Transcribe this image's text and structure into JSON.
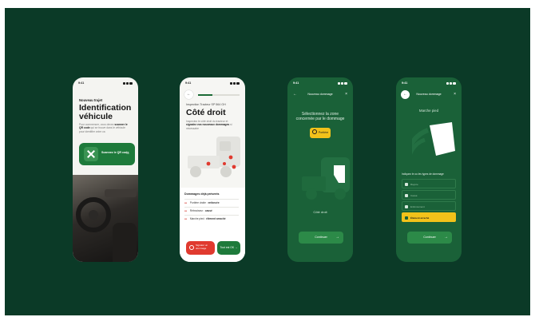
{
  "screens": [
    {
      "status_time": "9:41",
      "label": "Nouveau trajet",
      "title": "Identification véhicule",
      "description_pre": "Pour commencer, vous devez",
      "description_bold": "scanner le QR code",
      "description_post": "qui se trouve dans le véhicule pour identifier votre ca",
      "scan_card_label": "Scannez le QR code",
      "arrow": "→"
    },
    {
      "status_time": "9:41",
      "back_icon": "←",
      "subtitle": "Inspection Tracteur SP 564 GH",
      "title": "Côté droit",
      "description_pre": "Inspectez le côté droit du tracteur et",
      "description_bold": "signalez vos nouveaux dommages",
      "description_post": "si nécessaire",
      "damages_heading": "Dommages déjà présents",
      "damages": [
        {
          "zone": "Portière droite",
          "type": "enfoncée"
        },
        {
          "zone": "Rétroviseur",
          "type": "cassé"
        },
        {
          "zone": "Marche pied",
          "type": "élément arraché"
        }
      ],
      "report_button": "Signaler un dommage",
      "next_button": "Tout est OK",
      "next_arrow": "→"
    },
    {
      "status_time": "9:41",
      "header_title": "Nouveau dommage",
      "header_left": "←",
      "header_right": "×",
      "question": "Sélectionnez la zone concernée par le dommage",
      "selected_zone": "Portière",
      "side_label": "Côté droit",
      "continue_button": "Continuer",
      "continue_arrow": "→"
    },
    {
      "status_time": "9:41",
      "header_title": "Nouveau dommage",
      "header_left": "←",
      "header_right": "×",
      "zone_label": "Marche pied",
      "question": "Indiquez le ou les types de dommage",
      "options": [
        {
          "label": "Rayure",
          "selected": false
        },
        {
          "label": "Cassé",
          "selected": false
        },
        {
          "label": "Enfoncement",
          "selected": false
        },
        {
          "label": "Élément arraché",
          "selected": true
        }
      ],
      "continue_button": "Continuer",
      "continue_arrow": "→"
    }
  ],
  "colors": {
    "background": "#0b3a27",
    "brand_green": "#1e7a3b",
    "dark_green": "#1a6138",
    "alert_red": "#e03a2f",
    "highlight_yellow": "#f2c21a"
  }
}
